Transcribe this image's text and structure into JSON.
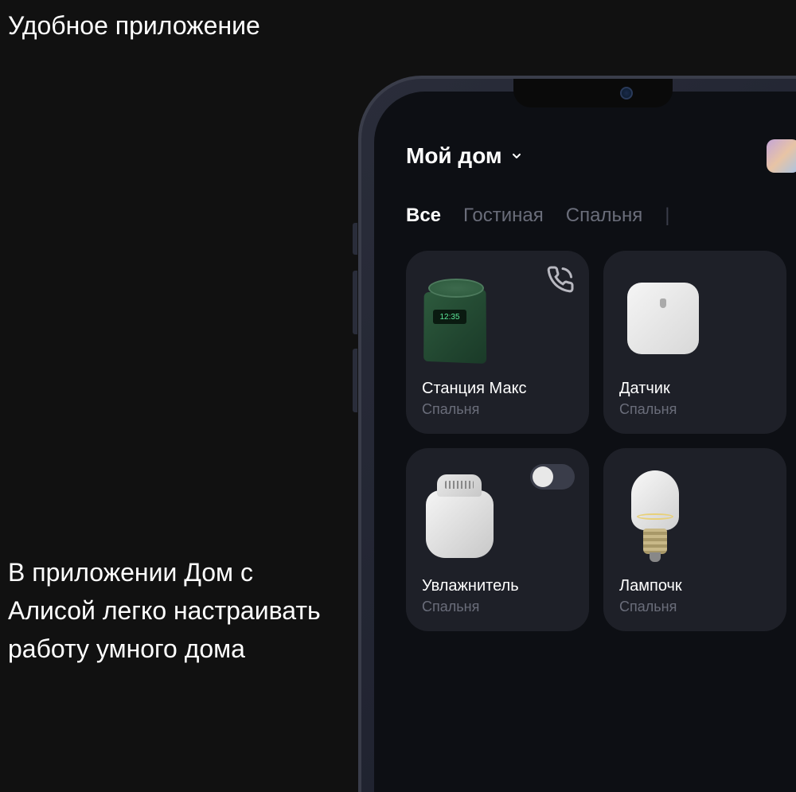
{
  "page": {
    "title": "Удобное приложение",
    "description": "В приложении Дом с Алисой легко настраивать работу умного дома"
  },
  "app": {
    "home_label": "Мой дом",
    "speaker_time": "12:35",
    "tabs": [
      {
        "label": "Все",
        "active": true
      },
      {
        "label": "Гостиная",
        "active": false
      },
      {
        "label": "Спальня",
        "active": false
      }
    ],
    "devices": [
      {
        "name": "Станция Макс",
        "room": "Спальня",
        "type": "speaker",
        "action": "call"
      },
      {
        "name": "Датчик",
        "room": "Спальня",
        "type": "sensor",
        "action": "none"
      },
      {
        "name": "Увлажнитель",
        "room": "Спальня",
        "type": "humidifier",
        "action": "toggle",
        "toggle_on": false
      },
      {
        "name": "Лампочк",
        "room": "Спальня",
        "type": "bulb",
        "action": "none"
      }
    ]
  }
}
